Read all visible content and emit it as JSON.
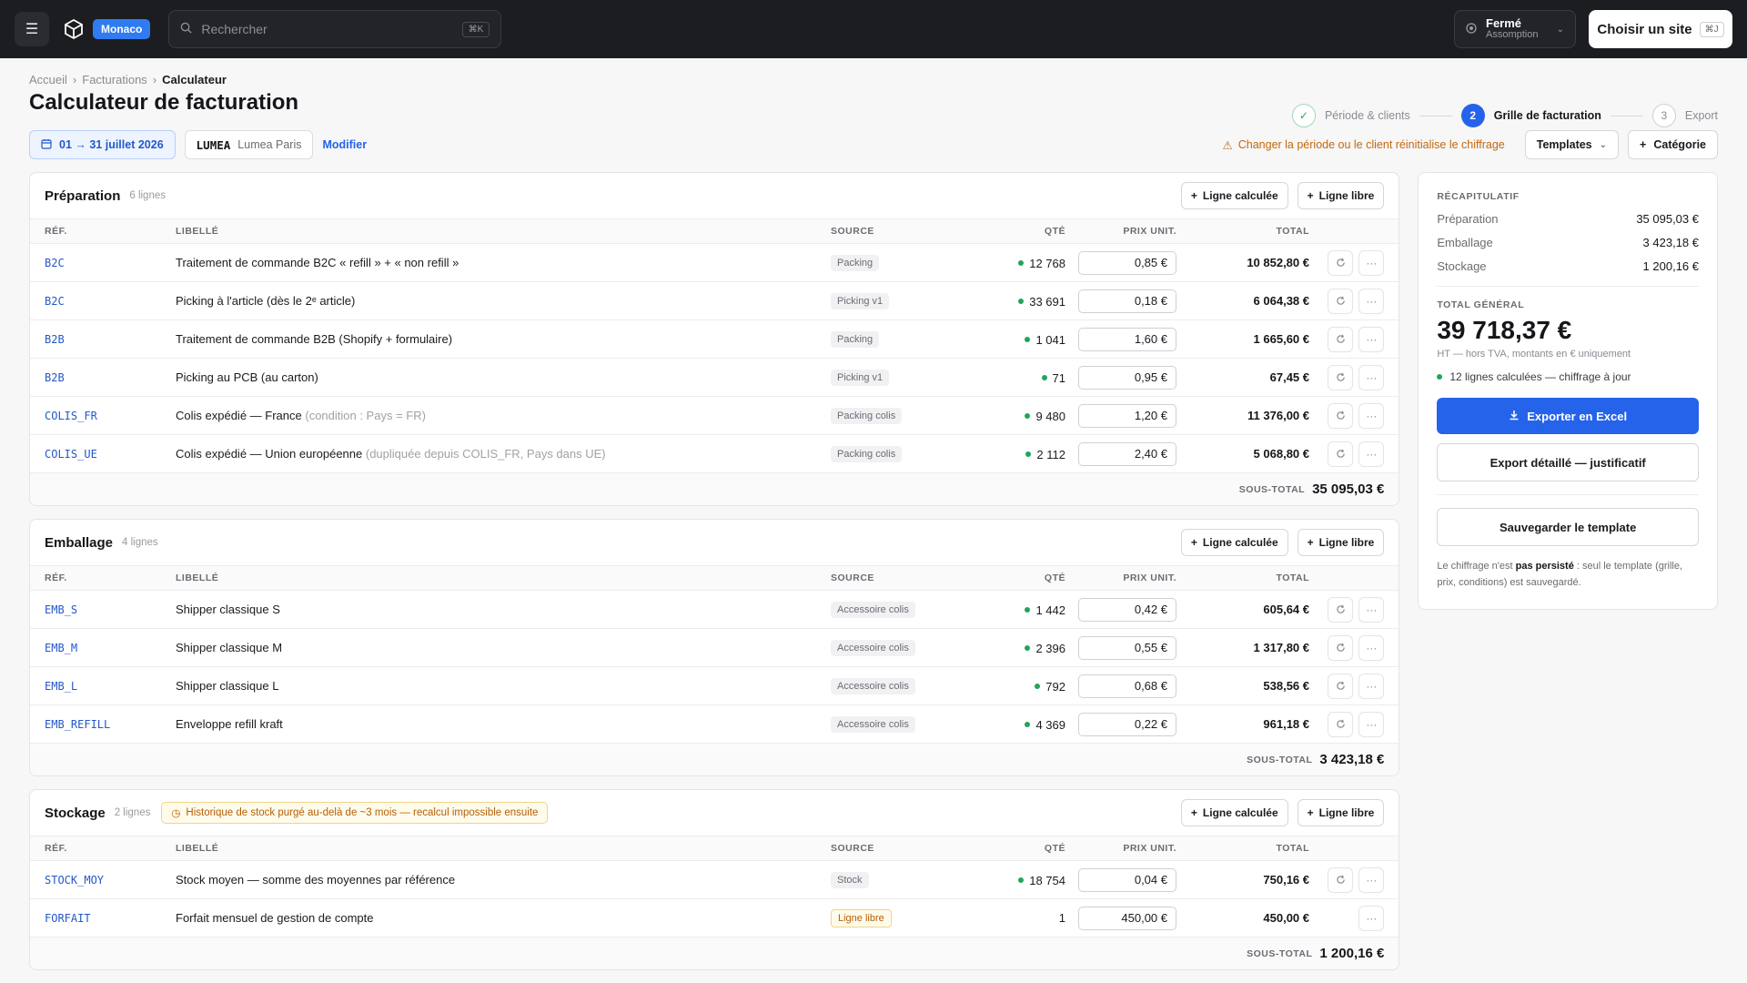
{
  "topbar": {
    "site_badge": "Monaco",
    "search_placeholder": "Rechercher",
    "search_kbd": "⌘K",
    "status_title": "Fermé",
    "status_sub": "Assomption",
    "choose_site": "Choisir un site",
    "choose_kbd": "⌘J"
  },
  "breadcrumb": {
    "items": [
      "Accueil",
      "Facturations"
    ],
    "current": "Calculateur"
  },
  "page_title": "Calculateur de facturation",
  "stepper": {
    "step1": "Période & clients",
    "step2_num": "2",
    "step2": "Grille de facturation",
    "step3_num": "3",
    "step3": "Export"
  },
  "filters": {
    "date_range": "01 → 31 juillet 2026",
    "client_code": "LUMEA",
    "client_name": "Lumea Paris",
    "modify": "Modifier",
    "warning": "Changer la période ou le client réinitialise le chiffrage",
    "templates": "Templates",
    "category": "Catégorie"
  },
  "table_headers": {
    "ref": "RÉF.",
    "lib": "LIBELLÉ",
    "src": "SOURCE",
    "qty": "QTÉ",
    "price": "PRIX UNIT.",
    "total": "TOTAL"
  },
  "actions": {
    "calc": "Ligne calculée",
    "free": "Ligne libre"
  },
  "subtotal_label": "SOUS-TOTAL",
  "sections": [
    {
      "name": "Préparation",
      "count": "6 lignes",
      "subtotal": "35 095,03 €",
      "rows": [
        {
          "ref": "B2C",
          "lib": "Traitement de commande B2C « refill » + « non refill »",
          "note": "",
          "src": "Packing",
          "qty": "12 768",
          "price": "0,85 €",
          "total": "10 852,80 €"
        },
        {
          "ref": "B2C",
          "lib": "Picking à l'article (dès le 2ᵉ article)",
          "note": "",
          "src": "Picking v1",
          "qty": "33 691",
          "price": "0,18 €",
          "total": "6 064,38 €"
        },
        {
          "ref": "B2B",
          "lib": "Traitement de commande B2B (Shopify + formulaire)",
          "note": "",
          "src": "Packing",
          "qty": "1 041",
          "price": "1,60 €",
          "total": "1 665,60 €"
        },
        {
          "ref": "B2B",
          "lib": "Picking au PCB (au carton)",
          "note": "",
          "src": "Picking v1",
          "qty": "71",
          "price": "0,95 €",
          "total": "67,45 €"
        },
        {
          "ref": "COLIS_FR",
          "lib": "Colis expédié — France",
          "note": "(condition : Pays = FR)",
          "src": "Packing colis",
          "qty": "9 480",
          "price": "1,20 €",
          "total": "11 376,00 €"
        },
        {
          "ref": "COLIS_UE",
          "lib": "Colis expédié — Union européenne",
          "note": "(dupliquée depuis COLIS_FR, Pays dans UE)",
          "src": "Packing colis",
          "qty": "2 112",
          "price": "2,40 €",
          "total": "5 068,80 €"
        }
      ]
    },
    {
      "name": "Emballage",
      "count": "4 lignes",
      "subtotal": "3 423,18 €",
      "rows": [
        {
          "ref": "EMB_S",
          "lib": "Shipper classique S",
          "note": "",
          "src": "Accessoire colis",
          "qty": "1 442",
          "price": "0,42 €",
          "total": "605,64 €"
        },
        {
          "ref": "EMB_M",
          "lib": "Shipper classique M",
          "note": "",
          "src": "Accessoire colis",
          "qty": "2 396",
          "price": "0,55 €",
          "total": "1 317,80 €"
        },
        {
          "ref": "EMB_L",
          "lib": "Shipper classique L",
          "note": "",
          "src": "Accessoire colis",
          "qty": "792",
          "price": "0,68 €",
          "total": "538,56 €"
        },
        {
          "ref": "EMB_REFILL",
          "lib": "Enveloppe refill kraft",
          "note": "",
          "src": "Accessoire colis",
          "qty": "4 369",
          "price": "0,22 €",
          "total": "961,18 €"
        }
      ]
    },
    {
      "name": "Stockage",
      "count": "2 lignes",
      "subtotal": "1 200,16 €",
      "warning": "Historique de stock purgé au-delà de ~3 mois — recalcul impossible ensuite",
      "rows": [
        {
          "ref": "STOCK_MOY",
          "lib": "Stock moyen — somme des moyennes par référence",
          "note": "",
          "src": "Stock",
          "qty": "18 754",
          "price": "0,04 €",
          "total": "750,16 €"
        },
        {
          "ref": "FORFAIT",
          "lib": "Forfait mensuel de gestion de compte",
          "note": "",
          "src": "Ligne libre",
          "qty": "1",
          "price": "450,00 €",
          "total": "450,00 €"
        }
      ]
    }
  ],
  "summary": {
    "title": "RÉCAPITULATIF",
    "lines": [
      {
        "label": "Préparation",
        "value": "35 095,03 €"
      },
      {
        "label": "Emballage",
        "value": "3 423,18 €"
      },
      {
        "label": "Stockage",
        "value": "1 200,16 €"
      }
    ],
    "grand_label": "TOTAL GÉNÉRAL",
    "grand_value": "39 718,37 €",
    "grand_note": "HT — hors TVA, montants en € uniquement",
    "ok_note": "12 lignes calculées — chiffrage à jour",
    "export_excel": "Exporter en Excel",
    "export_detail": "Export détaillé — justificatif",
    "save_template": "Sauvegarder le template",
    "fine_a": "Le chiffrage n'est ",
    "fine_b": "pas persisté",
    "fine_c": " : seul le template (grille, prix, conditions) est sauvegardé."
  },
  "colors": {
    "accent": "#2563eb",
    "ok": "#22a45a",
    "warn": "#c2680c"
  }
}
